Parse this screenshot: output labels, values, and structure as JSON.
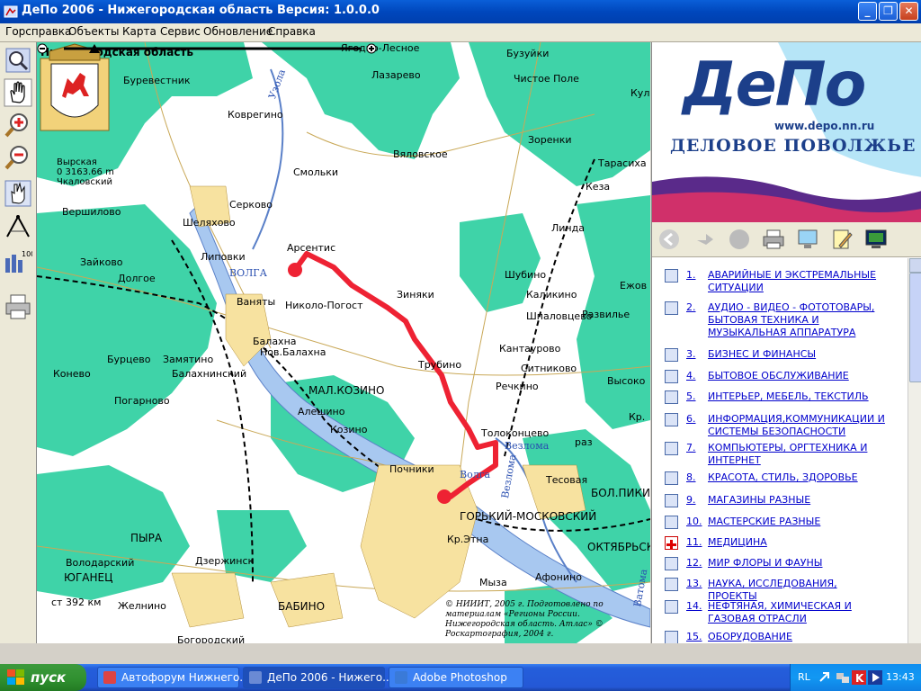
{
  "window": {
    "title": "ДеПо 2006 - Нижегородская область Версия: 1.0.0.0"
  },
  "menu": [
    "Горсправка",
    "Объекты",
    "Карта",
    "Сервис",
    "Обновление",
    "Справка"
  ],
  "map": {
    "region_title": "Нижегородская область",
    "coat_label": "Нижегородская область (герб)",
    "info": {
      "place": "Вырская",
      "distance": "0 3163.66 m",
      "district": "Чкаловский"
    },
    "scale_text": "ст 392 км",
    "copyright": "© НИИИТ, 2005 г. Подготовлено по материалам «Регионы России. Нижегородская область. Атлас» © Роскартография, 2004 г.",
    "labels": {
      "l0": "Ягодно-Лесное",
      "l1": "Бузуйки",
      "l2": "Буревестник",
      "l3": "Лазарево",
      "l4": "Чистое Поле",
      "l5": "Коврегино",
      "l6": "Вяловское",
      "l7": "Зоренки",
      "l8": "Выгская",
      "l9": "Смольки",
      "l10": "Тарасиха",
      "l11": "Кеза",
      "l12": "Серково",
      "l13": "Вершилово",
      "l14": "Шеляхово",
      "l15": "Арсентис",
      "l16": "Линда",
      "l17": "Зайково",
      "l18": "Липовки",
      "l19": "ВОЛГА",
      "l20": "Шубино",
      "l21": "Долгое",
      "l22": "Ваняты",
      "l23": "Николо-Погост",
      "l24": "Зиняки",
      "l25": "Каликино",
      "l26": "Ежов",
      "l27": "Шпаловцево",
      "l28": "Развилье",
      "l29": "Нов.Балахна",
      "l30": "Балахна",
      "l31": "Кантаурово",
      "l32": "Бурцево",
      "l33": "Замятино",
      "l34": "Ситниково",
      "l35": "Конево",
      "l36": "Балахнинский",
      "l37": "Трубино",
      "l38": "Высоко",
      "l39": "Речкино",
      "l40": "МАЛ.КОЗИНО",
      "l41": "Погарново",
      "l42": "Алешино",
      "l43": "Кр.",
      "l44": "Козино",
      "l45": "Толоконцево",
      "l46": "Везлома",
      "l47": "раз",
      "l48": "Почники",
      "l49": "Волга",
      "l50": "Тесовая",
      "l51": "БОЛ.ПИКИ",
      "l52": "ГОРЬКИЙ-МОСКОВСКИЙ",
      "l53": "Кр.Этна",
      "l54": "ПЫРА",
      "l55": "ОКТЯБРЬСКИЙ",
      "l56": "Володарский",
      "l57": "Дзержинск",
      "l58": "ЮГАНЕЦ",
      "l59": "Мыза",
      "l60": "Афонино",
      "l61": "Желнино",
      "l62": "БАБИНО",
      "l63": "Богородский",
      "l64": "Узола",
      "l65": "Везлома",
      "l66": "Ватома",
      "l67": "Кул",
      "l68": "Кеза"
    }
  },
  "banner": {
    "logo": "ДеПо",
    "url": "www.depo.nn.ru",
    "slogan": "ДЕЛОВОЕ ПОВОЛЖЬЕ"
  },
  "categories": [
    {
      "num": "1.",
      "text": "АВАРИЙНЫЕ И ЭКСТРЕМАЛЬНЫЕ СИТУАЦИИ"
    },
    {
      "num": "2.",
      "text": "АУДИО - ВИДЕО - ФОТОТОВАРЫ, БЫТОВАЯ ТЕХНИКА И МУЗЫКАЛЬНАЯ АППАРАТУРА"
    },
    {
      "num": "3.",
      "text": "БИЗНЕС И ФИНАНСЫ"
    },
    {
      "num": "4.",
      "text": "БЫТОВОЕ ОБСЛУЖИВАНИЕ"
    },
    {
      "num": "5.",
      "text": "ИНТЕРЬЕР, МЕБЕЛЬ, ТЕКСТИЛЬ"
    },
    {
      "num": "6.",
      "text": "ИНФОРМАЦИЯ,КОММУНИКАЦИИ И СИСТЕМЫ БЕЗОПАСНОСТИ"
    },
    {
      "num": "7.",
      "text": "КОМПЬЮТЕРЫ, ОРГТЕХНИКА И ИНТЕРНЕТ"
    },
    {
      "num": "8.",
      "text": "КРАСОТА, СТИЛЬ, ЗДОРОВЬЕ"
    },
    {
      "num": "9.",
      "text": "МАГАЗИНЫ РАЗНЫЕ"
    },
    {
      "num": "10.",
      "text": "МАСТЕРСКИЕ РАЗНЫЕ"
    },
    {
      "num": "11.",
      "text": "МЕДИЦИНА"
    },
    {
      "num": "12.",
      "text": "МИР ФЛОРЫ И ФАУНЫ"
    },
    {
      "num": "13.",
      "text": "НАУКА, ИССЛЕДОВАНИЯ, ПРОЕКТЫ"
    },
    {
      "num": "14.",
      "text": "НЕФТЯНАЯ, ХИМИЧЕСКАЯ И ГАЗОВАЯ ОТРАСЛИ"
    },
    {
      "num": "15.",
      "text": "ОБОРУДОВАНИЕ"
    }
  ],
  "taskbar": {
    "start": "пуск",
    "tasks": [
      "Автофорум Нижнего...",
      "ДеПо 2006 - Нижего...",
      "Adobe Photoshop"
    ],
    "lang": "RL",
    "time": "13:43"
  },
  "colors": {
    "forest": "#3fd3a8",
    "route": "#ee2233",
    "accent": "#245edb"
  }
}
